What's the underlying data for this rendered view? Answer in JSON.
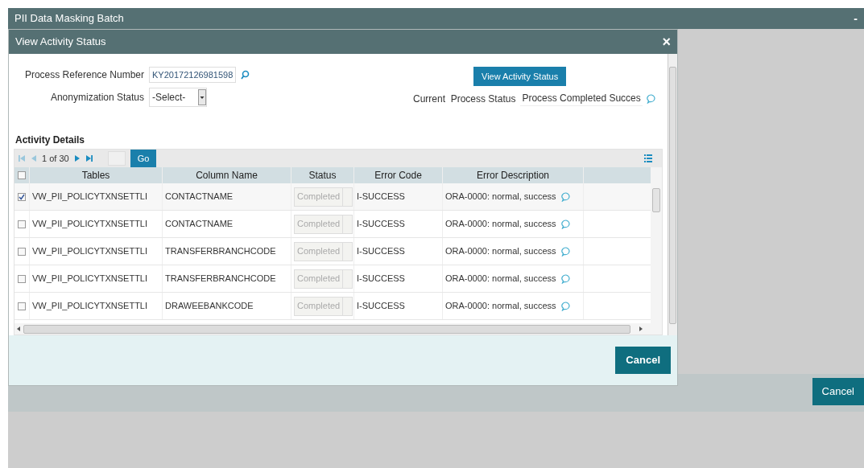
{
  "window": {
    "title": "PII Data Masking Batch",
    "minimize": "-"
  },
  "dialog": {
    "title": "View Activity Status",
    "close": "×",
    "fields": {
      "reference": {
        "label": "Process Reference Number",
        "value": "KY20172126981598"
      },
      "anonymization": {
        "label": "Anonymization Status",
        "value": "-Select-"
      },
      "view_button": "View Activity Status",
      "current_status": {
        "label": "Current  Process Status",
        "value": "Process Completed Succes"
      }
    },
    "section_title": "Activity Details",
    "pager": {
      "page": "1 of 30",
      "go": "Go"
    },
    "table": {
      "header_checked": false,
      "columns": [
        "Tables",
        "Column Name",
        "Status",
        "Error Code",
        "Error Description"
      ],
      "rows": [
        {
          "checked": true,
          "cells": [
            "VW_PII_POLICYTXNSETTLI",
            "CONTACTNAME",
            "Completed",
            "I-SUCCESS",
            "ORA-0000: normal, success"
          ]
        },
        {
          "checked": false,
          "cells": [
            "VW_PII_POLICYTXNSETTLI",
            "CONTACTNAME",
            "Completed",
            "I-SUCCESS",
            "ORA-0000: normal, success"
          ]
        },
        {
          "checked": false,
          "cells": [
            "VW_PII_POLICYTXNSETTLI",
            "TRANSFERBRANCHCODE",
            "Completed",
            "I-SUCCESS",
            "ORA-0000: normal, success"
          ]
        },
        {
          "checked": false,
          "cells": [
            "VW_PII_POLICYTXNSETTLI",
            "TRANSFERBRANCHCODE",
            "Completed",
            "I-SUCCESS",
            "ORA-0000: normal, success"
          ]
        },
        {
          "checked": false,
          "cells": [
            "VW_PII_POLICYTXNSETTLI",
            "DRAWEEBANKCODE",
            "Completed",
            "I-SUCCESS",
            "ORA-0000: normal, success"
          ]
        }
      ]
    },
    "cancel": "Cancel"
  },
  "page_cancel": "Cancel"
}
